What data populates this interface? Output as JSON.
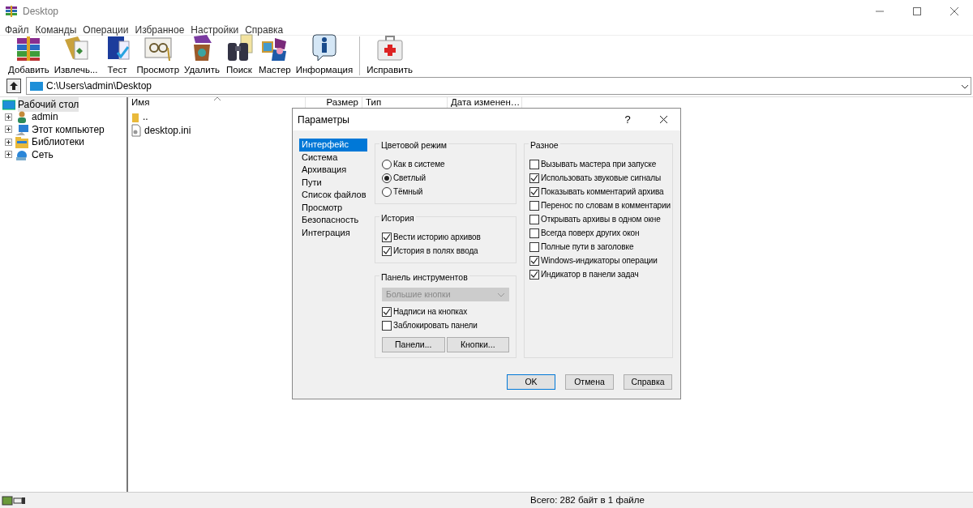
{
  "window": {
    "title": "Desktop"
  },
  "menu": [
    "Файл",
    "Команды",
    "Операции",
    "Избранное",
    "Настройки",
    "Справка"
  ],
  "toolbar": [
    {
      "label": "Добавить",
      "separator_before": false
    },
    {
      "label": "Извлечь...",
      "separator_before": false
    },
    {
      "label": "Тест",
      "separator_before": false
    },
    {
      "label": "Просмотр",
      "separator_before": false
    },
    {
      "label": "Удалить",
      "separator_before": false
    },
    {
      "label": "Поиск",
      "separator_before": false
    },
    {
      "label": "Мастер",
      "separator_before": false
    },
    {
      "label": "Информация",
      "separator_before": false
    },
    {
      "label": "Исправить",
      "separator_before": true
    }
  ],
  "address": {
    "value": "C:\\Users\\admin\\Desktop"
  },
  "tree": [
    {
      "label": "Рабочий стол",
      "selected": true,
      "children": [
        {
          "label": "admin",
          "selected": false
        },
        {
          "label": "Этот компьютер",
          "selected": false
        },
        {
          "label": "Библиотеки",
          "selected": false
        },
        {
          "label": "Сеть",
          "selected": false
        }
      ]
    }
  ],
  "file_list": {
    "columns": [
      "Имя",
      "Размер",
      "Тип",
      "Дата изменен…"
    ],
    "rows": [
      {
        "name": "..",
        "kind": "folder"
      },
      {
        "name": "desktop.ini",
        "kind": "file"
      }
    ]
  },
  "dialog": {
    "title": "Параметры",
    "help": "?",
    "categories": [
      {
        "label": "Интерфейс",
        "selected": true
      },
      {
        "label": "Система",
        "selected": false
      },
      {
        "label": "Архивация",
        "selected": false
      },
      {
        "label": "Пути",
        "selected": false
      },
      {
        "label": "Список файлов",
        "selected": false
      },
      {
        "label": "Просмотр",
        "selected": false
      },
      {
        "label": "Безопасность",
        "selected": false
      },
      {
        "label": "Интеграция",
        "selected": false
      }
    ],
    "color_mode": {
      "title": "Цветовой режим",
      "options": [
        {
          "label": "Как в системе",
          "selected": false
        },
        {
          "label": "Светлый",
          "selected": true
        },
        {
          "label": "Тёмный",
          "selected": false
        }
      ]
    },
    "history": {
      "title": "История",
      "options": [
        {
          "label": "Вести историю архивов",
          "checked": true
        },
        {
          "label": "История в полях ввода",
          "checked": true
        }
      ]
    },
    "toolbar_panel": {
      "title": "Панель инструментов",
      "dropdown": {
        "value": "Большие кнопки",
        "disabled": true
      },
      "options": [
        {
          "label": "Надписи на кнопках",
          "checked": true
        },
        {
          "label": "Заблокировать панели",
          "checked": false
        }
      ],
      "buttons": [
        "Панели...",
        "Кнопки..."
      ]
    },
    "misc": {
      "title": "Разное",
      "options": [
        {
          "label": "Вызывать мастера при запуске",
          "checked": false
        },
        {
          "label": "Использовать звуковые сигналы",
          "checked": true
        },
        {
          "label": "Показывать комментарий архива",
          "checked": true
        },
        {
          "label": "Перенос по словам в комментарии",
          "checked": false
        },
        {
          "label": "Открывать архивы в одном окне",
          "checked": false
        },
        {
          "label": "Всегда поверх других окон",
          "checked": false
        },
        {
          "label": "Полные пути в заголовке",
          "checked": false
        },
        {
          "label": "Windows-индикаторы операции",
          "checked": true
        },
        {
          "label": "Индикатор в панели задач",
          "checked": true
        }
      ]
    },
    "buttons": [
      {
        "label": "OK",
        "default": true
      },
      {
        "label": "Отмена",
        "default": false
      },
      {
        "label": "Справка",
        "default": false
      }
    ]
  },
  "status_bar": {
    "text": "Всего: 282 байт в 1 файле"
  }
}
